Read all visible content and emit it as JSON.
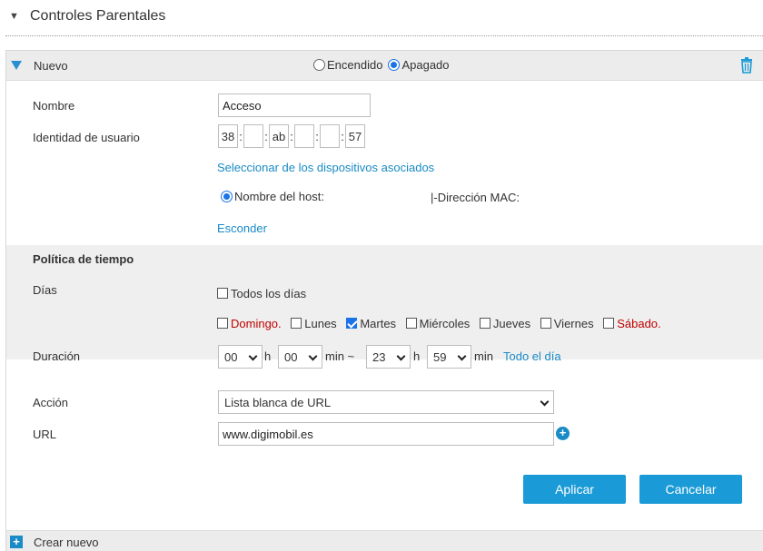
{
  "section": {
    "title": "Controles Parentales"
  },
  "rule": {
    "name": "Nuevo",
    "status_on_label": "Encendido",
    "status_off_label": "Apagado",
    "status_selected": "Apagado"
  },
  "form": {
    "name_label": "Nombre",
    "name_value": "Acceso",
    "user_id_label": "Identidad de usuario",
    "mac_parts": [
      "38",
      "",
      "ab",
      "",
      "",
      "57"
    ],
    "select_devices_link": "Seleccionar de los dispositivos asociados",
    "hostname_label": "Nombre del host:",
    "mac_label": "|-Dirección MAC:",
    "hide_link": "Esconder"
  },
  "time_policy": {
    "heading": "Política de tiempo",
    "days_label": "Días",
    "all_days_label": "Todos los días",
    "all_days_checked": false,
    "days": [
      {
        "label": "Domingo.",
        "checked": false,
        "weekend": true
      },
      {
        "label": "Lunes",
        "checked": false,
        "weekend": false
      },
      {
        "label": "Martes",
        "checked": true,
        "weekend": false
      },
      {
        "label": "Miércoles",
        "checked": false,
        "weekend": false
      },
      {
        "label": "Jueves",
        "checked": false,
        "weekend": false
      },
      {
        "label": "Viernes",
        "checked": false,
        "weekend": false
      },
      {
        "label": "Sábado.",
        "checked": false,
        "weekend": true
      }
    ],
    "duration_label": "Duración",
    "start_hour": "00",
    "start_min": "00",
    "end_hour": "23",
    "end_min": "59",
    "hour_unit": "h",
    "min_unit_start": "min ~",
    "min_unit_end": "min",
    "all_day_link": "Todo el día"
  },
  "action": {
    "action_label": "Acción",
    "action_value": "Lista blanca de URL",
    "url_label": "URL",
    "url_value": "www.digimobil.es"
  },
  "buttons": {
    "apply": "Aplicar",
    "cancel": "Cancelar"
  },
  "footer": {
    "create_new": "Crear nuevo"
  },
  "colors": {
    "accent": "#1a9ad6",
    "link": "#1a8bc5",
    "weekend": "#c00000"
  },
  "icons": {
    "collapse": "triangle-down-icon",
    "delete": "trash-icon",
    "add": "plus-circle-icon",
    "create": "plus-square-icon"
  }
}
